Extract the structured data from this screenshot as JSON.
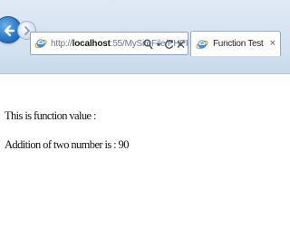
{
  "browser": {
    "address_bar": {
      "url_prefix": "http://",
      "url_host": "localhost",
      "url_path": ":55/MySiteFile/PHPFunction.php",
      "icons": [
        "search-icon",
        "refresh-icon",
        "close-icon"
      ]
    },
    "tab": {
      "title": "Function Test",
      "close_label": "×"
    }
  },
  "page": {
    "line1": "This is function value :",
    "line2": "Addition of two number is : 90"
  },
  "colors": {
    "back_button": "#2b78c7",
    "chrome_background": "#d3e1f1",
    "favicon": "#3a8fd8"
  }
}
